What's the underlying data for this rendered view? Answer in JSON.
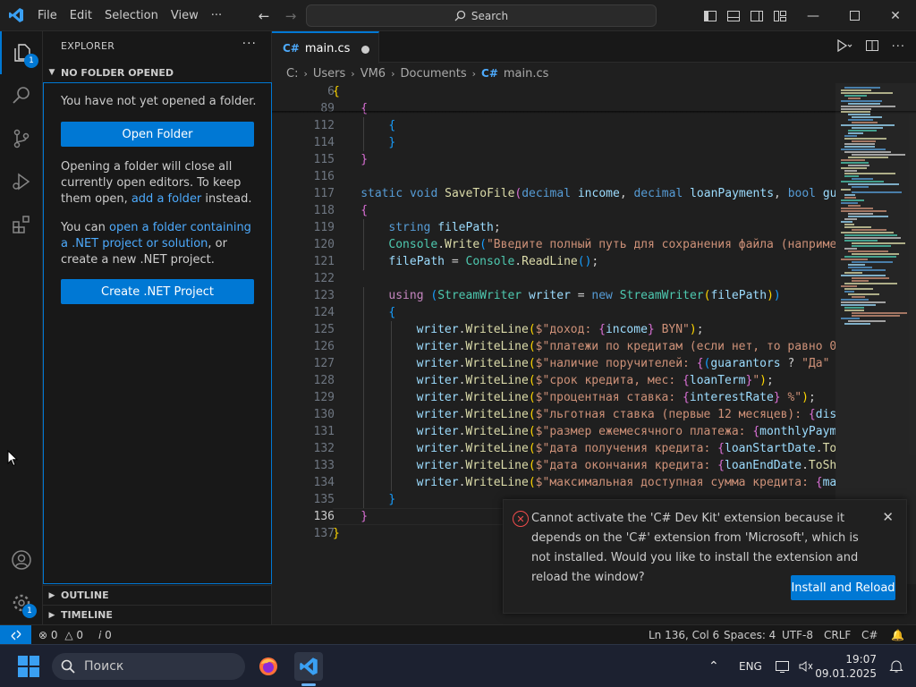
{
  "menu": {
    "file": "File",
    "edit": "Edit",
    "selection": "Selection",
    "view": "View",
    "more": "···"
  },
  "search": {
    "label": "Search"
  },
  "activity": {
    "explorer_badge": "1",
    "manage_badge": "1"
  },
  "sidebar": {
    "title": "EXPLORER",
    "section": "NO FOLDER OPENED",
    "p1": "You have not yet opened a folder.",
    "open_folder": "Open Folder",
    "p2_a": "Opening a folder will close all currently open editors. To keep them open, ",
    "p2_link": "add a folder",
    "p2_b": " instead.",
    "p3_a": "You can ",
    "p3_link": "open a folder containing a .NET project or solution",
    "p3_b": ", or create a new .NET project.",
    "create_project": "Create .NET Project",
    "outline": "OUTLINE",
    "timeline": "TIMELINE"
  },
  "editor": {
    "tab": "main.cs",
    "breadcrumb": [
      "C:",
      "Users",
      "VM6",
      "Documents",
      "main.cs"
    ],
    "lines": [
      {
        "n": "6",
        "indent": 0,
        "seg": [
          [
            "b1",
            "{"
          ]
        ]
      },
      {
        "n": "89",
        "indent": 1,
        "seg": [
          [
            "b2",
            "{"
          ]
        ]
      },
      {
        "n": "112",
        "indent": 2,
        "seg": [
          [
            "b3",
            "{"
          ]
        ]
      },
      {
        "n": "114",
        "indent": 2,
        "seg": [
          [
            "b3",
            "}"
          ]
        ]
      },
      {
        "n": "115",
        "indent": 1,
        "seg": [
          [
            "b2",
            "}"
          ]
        ]
      },
      {
        "n": "116",
        "indent": 0,
        "seg": []
      },
      {
        "n": "117",
        "indent": 1,
        "seg": [
          [
            "kw",
            "static "
          ],
          [
            "kw",
            "void "
          ],
          [
            "fn",
            "SaveToFile"
          ],
          [
            "b2",
            "("
          ],
          [
            "kw",
            "decimal "
          ],
          [
            "va",
            "income"
          ],
          [
            "pu",
            ", "
          ],
          [
            "kw",
            "decimal "
          ],
          [
            "va",
            "loanPayments"
          ],
          [
            "pu",
            ", "
          ],
          [
            "kw",
            "bool "
          ],
          [
            "va",
            "gua"
          ]
        ]
      },
      {
        "n": "118",
        "indent": 1,
        "seg": [
          [
            "b2",
            "{"
          ]
        ]
      },
      {
        "n": "119",
        "indent": 2,
        "seg": [
          [
            "kw",
            "string "
          ],
          [
            "va",
            "filePath"
          ],
          [
            "pu",
            ";"
          ]
        ]
      },
      {
        "n": "120",
        "indent": 2,
        "seg": [
          [
            "ty",
            "Console"
          ],
          [
            "pu",
            "."
          ],
          [
            "fn",
            "Write"
          ],
          [
            "b3",
            "("
          ],
          [
            "st",
            "\"Введите полный путь для сохранения файла (наприме"
          ]
        ]
      },
      {
        "n": "121",
        "indent": 2,
        "seg": [
          [
            "va",
            "filePath"
          ],
          [
            "pu",
            " = "
          ],
          [
            "ty",
            "Console"
          ],
          [
            "pu",
            "."
          ],
          [
            "fn",
            "ReadLine"
          ],
          [
            "b3",
            "()"
          ],
          [
            "pu",
            ";"
          ]
        ]
      },
      {
        "n": "122",
        "indent": 0,
        "seg": []
      },
      {
        "n": "123",
        "indent": 2,
        "seg": [
          [
            "cf",
            "using "
          ],
          [
            "b3",
            "("
          ],
          [
            "ty",
            "StreamWriter "
          ],
          [
            "va",
            "writer"
          ],
          [
            "pu",
            " = "
          ],
          [
            "kw",
            "new "
          ],
          [
            "ty",
            "StreamWriter"
          ],
          [
            "b1",
            "("
          ],
          [
            "va",
            "filePath"
          ],
          [
            "b1",
            ")"
          ],
          [
            "b3",
            ")"
          ]
        ]
      },
      {
        "n": "124",
        "indent": 2,
        "seg": [
          [
            "b3",
            "{"
          ]
        ]
      },
      {
        "n": "125",
        "indent": 3,
        "seg": [
          [
            "va",
            "writer"
          ],
          [
            "pu",
            "."
          ],
          [
            "fn",
            "WriteLine"
          ],
          [
            "b1",
            "("
          ],
          [
            "st",
            "$\"доход: "
          ],
          [
            "b2",
            "{"
          ],
          [
            "va",
            "income"
          ],
          [
            "b2",
            "}"
          ],
          [
            "st",
            " BYN\""
          ],
          [
            "b1",
            ")"
          ],
          [
            "pu",
            ";"
          ]
        ]
      },
      {
        "n": "126",
        "indent": 3,
        "seg": [
          [
            "va",
            "writer"
          ],
          [
            "pu",
            "."
          ],
          [
            "fn",
            "WriteLine"
          ],
          [
            "b1",
            "("
          ],
          [
            "st",
            "$\"платежи по кредитам (если нет, то равно 0"
          ]
        ]
      },
      {
        "n": "127",
        "indent": 3,
        "seg": [
          [
            "va",
            "writer"
          ],
          [
            "pu",
            "."
          ],
          [
            "fn",
            "WriteLine"
          ],
          [
            "b1",
            "("
          ],
          [
            "st",
            "$\"наличие поручителей: "
          ],
          [
            "b2",
            "{"
          ],
          [
            "b3",
            "("
          ],
          [
            "va",
            "guarantors"
          ],
          [
            "pu",
            " ? "
          ],
          [
            "st",
            "\"Да\""
          ]
        ]
      },
      {
        "n": "128",
        "indent": 3,
        "seg": [
          [
            "va",
            "writer"
          ],
          [
            "pu",
            "."
          ],
          [
            "fn",
            "WriteLine"
          ],
          [
            "b1",
            "("
          ],
          [
            "st",
            "$\"срок кредита, мес: "
          ],
          [
            "b2",
            "{"
          ],
          [
            "va",
            "loanTerm"
          ],
          [
            "b2",
            "}"
          ],
          [
            "st",
            "\""
          ],
          [
            "b1",
            ")"
          ],
          [
            "pu",
            ";"
          ]
        ]
      },
      {
        "n": "129",
        "indent": 3,
        "seg": [
          [
            "va",
            "writer"
          ],
          [
            "pu",
            "."
          ],
          [
            "fn",
            "WriteLine"
          ],
          [
            "b1",
            "("
          ],
          [
            "st",
            "$\"процентная ставка: "
          ],
          [
            "b2",
            "{"
          ],
          [
            "va",
            "interestRate"
          ],
          [
            "b2",
            "}"
          ],
          [
            "st",
            " %\""
          ],
          [
            "b1",
            ")"
          ],
          [
            "pu",
            ";"
          ]
        ]
      },
      {
        "n": "130",
        "indent": 3,
        "seg": [
          [
            "va",
            "writer"
          ],
          [
            "pu",
            "."
          ],
          [
            "fn",
            "WriteLine"
          ],
          [
            "b1",
            "("
          ],
          [
            "st",
            "$\"льготная ставка (первые 12 месяцев): "
          ],
          [
            "b2",
            "{"
          ],
          [
            "va",
            "dis"
          ]
        ]
      },
      {
        "n": "131",
        "indent": 3,
        "seg": [
          [
            "va",
            "writer"
          ],
          [
            "pu",
            "."
          ],
          [
            "fn",
            "WriteLine"
          ],
          [
            "b1",
            "("
          ],
          [
            "st",
            "$\"размер ежемесячного платежа: "
          ],
          [
            "b2",
            "{"
          ],
          [
            "va",
            "monthlyPayme"
          ]
        ]
      },
      {
        "n": "132",
        "indent": 3,
        "seg": [
          [
            "va",
            "writer"
          ],
          [
            "pu",
            "."
          ],
          [
            "fn",
            "WriteLine"
          ],
          [
            "b1",
            "("
          ],
          [
            "st",
            "$\"дата получения кредита: "
          ],
          [
            "b2",
            "{"
          ],
          [
            "va",
            "loanStartDate"
          ],
          [
            "pu",
            "."
          ],
          [
            "fn",
            "To"
          ]
        ]
      },
      {
        "n": "133",
        "indent": 3,
        "seg": [
          [
            "va",
            "writer"
          ],
          [
            "pu",
            "."
          ],
          [
            "fn",
            "WriteLine"
          ],
          [
            "b1",
            "("
          ],
          [
            "st",
            "$\"дата окончания кредита: "
          ],
          [
            "b2",
            "{"
          ],
          [
            "va",
            "loanEndDate"
          ],
          [
            "pu",
            "."
          ],
          [
            "fn",
            "ToSh"
          ]
        ]
      },
      {
        "n": "134",
        "indent": 3,
        "seg": [
          [
            "va",
            "writer"
          ],
          [
            "pu",
            "."
          ],
          [
            "fn",
            "WriteLine"
          ],
          [
            "b1",
            "("
          ],
          [
            "st",
            "$\"максимальная доступная сумма кредита: "
          ],
          [
            "b2",
            "{"
          ],
          [
            "va",
            "ma"
          ]
        ]
      },
      {
        "n": "135",
        "indent": 2,
        "seg": [
          [
            "b3",
            "}"
          ]
        ]
      },
      {
        "n": "136",
        "indent": 1,
        "seg": [
          [
            "b2",
            "}"
          ]
        ],
        "current": true
      },
      {
        "n": "137",
        "indent": 0,
        "seg": [
          [
            "b1",
            "}"
          ]
        ]
      }
    ]
  },
  "notification": {
    "message": "Cannot activate the 'C# Dev Kit' extension because it depends on the 'C#' extension from 'Microsoft', which is not installed. Would you like to install the extension and reload the window?",
    "button": "Install and Reload"
  },
  "status": {
    "errors": "0",
    "warnings": "0",
    "ports": "0",
    "position": "Ln 136, Col 6",
    "spaces": "Spaces: 4",
    "encoding": "UTF-8",
    "eol": "CRLF",
    "language": "C#"
  },
  "taskbar": {
    "search_placeholder": "Поиск",
    "lang": "ENG",
    "time": "19:07",
    "date": "09.01.2025"
  },
  "colors": {
    "accent": "#0078d4",
    "error": "#f14c4c",
    "link": "#4daafc"
  }
}
